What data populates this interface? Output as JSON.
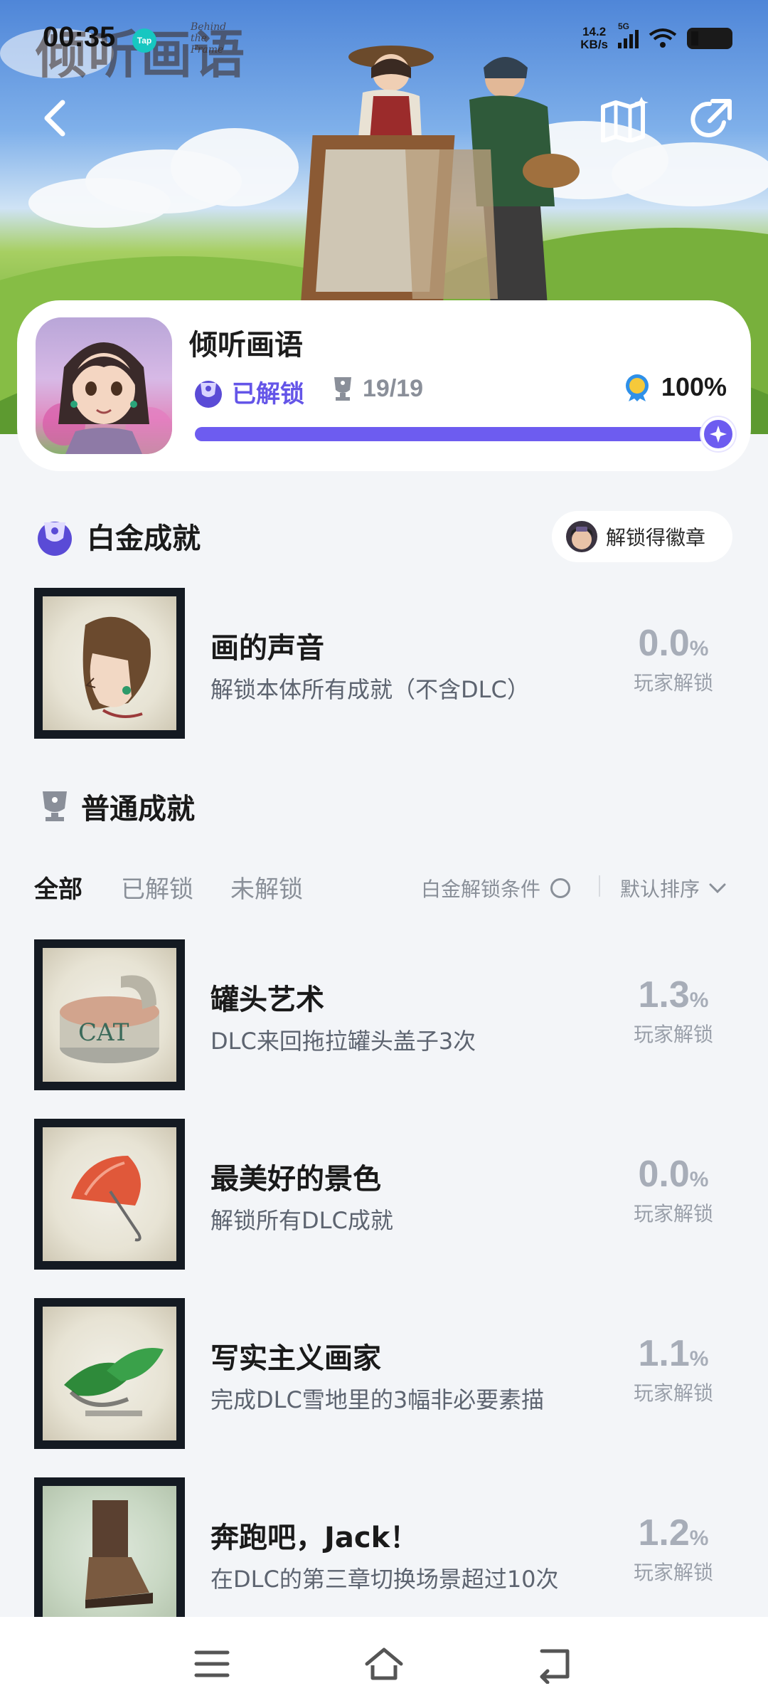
{
  "status_bar": {
    "time": "00:35",
    "tap_label": "Tap",
    "net_speed_value": "14.2",
    "net_speed_unit": "KB/s",
    "network_type": "5G"
  },
  "hero": {
    "logo_text": "倾听画语",
    "logo_subtitle": "Behind the Frame"
  },
  "game": {
    "title": "倾听画语",
    "unlock_status": "已解锁",
    "trophy_count": "19/19",
    "completion": "100%",
    "progress": 1.0,
    "accent_color": "#6d5cf0"
  },
  "platinum": {
    "section_title": "白金成就",
    "badge_button": "解锁得徽章",
    "item": {
      "name": "画的声音",
      "desc": "解锁本体所有成就（不含DLC）",
      "rate": "0.0",
      "rate_unit": "%",
      "rate_label": "玩家解锁"
    }
  },
  "normal": {
    "section_title": "普通成就",
    "tabs": [
      "全部",
      "已解锁",
      "未解锁"
    ],
    "active_tab": "全部",
    "platinum_condition": "白金解锁条件",
    "sort_label": "默认排序",
    "items": [
      {
        "name": "罐头艺术",
        "desc": "DLC来回拖拉罐头盖子3次",
        "rate": "1.3",
        "rate_unit": "%",
        "rate_label": "玩家解锁"
      },
      {
        "name": "最美好的景色",
        "desc": "解锁所有DLC成就",
        "rate": "0.0",
        "rate_unit": "%",
        "rate_label": "玩家解锁"
      },
      {
        "name": "写实主义画家",
        "desc": "完成DLC雪地里的3幅非必要素描",
        "rate": "1.1",
        "rate_unit": "%",
        "rate_label": "玩家解锁"
      },
      {
        "name": "奔跑吧，Jack！",
        "desc": "在DLC的第三章切换场景超过10次",
        "rate": "1.2",
        "rate_unit": "%",
        "rate_label": "玩家解锁"
      }
    ]
  },
  "icons": {
    "back": "back-arrow-icon",
    "map": "map-sparkle-icon",
    "share": "share-icon",
    "platinum_trophy": "platinum-trophy-icon",
    "trophy": "trophy-icon",
    "medal": "medal-icon",
    "menu": "menu-icon",
    "home": "home-icon",
    "return": "return-icon"
  }
}
